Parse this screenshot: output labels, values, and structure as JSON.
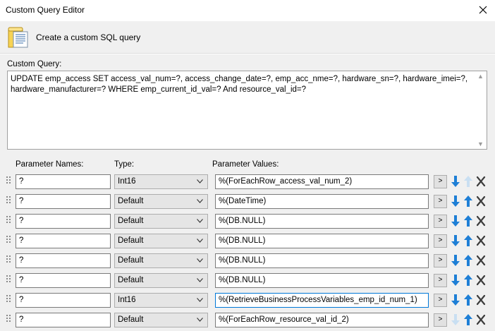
{
  "window": {
    "title": "Custom Query Editor"
  },
  "banner": {
    "text": "Create a custom SQL query"
  },
  "query": {
    "label": "Custom Query:",
    "text": "UPDATE emp_access SET access_val_num=?, access_change_date=?, emp_acc_nme=?, hardware_sn=?, hardware_imei=?, hardware_manufacturer=? WHERE emp_current_id_val=? And resource_val_id=?"
  },
  "columns": {
    "names": "Parameter Names:",
    "type": "Type:",
    "values": "Parameter Values:"
  },
  "more_label": ">",
  "params": [
    {
      "name": "?",
      "type": "Int16",
      "value": "%(ForEachRow_access_val_num_2)",
      "up_enabled": false,
      "down_enabled": true
    },
    {
      "name": "?",
      "type": "Default",
      "value": "%(DateTime)",
      "up_enabled": true,
      "down_enabled": true
    },
    {
      "name": "?",
      "type": "Default",
      "value": "%(DB.NULL)",
      "up_enabled": true,
      "down_enabled": true
    },
    {
      "name": "?",
      "type": "Default",
      "value": "%(DB.NULL)",
      "up_enabled": true,
      "down_enabled": true
    },
    {
      "name": "?",
      "type": "Default",
      "value": "%(DB.NULL)",
      "up_enabled": true,
      "down_enabled": true
    },
    {
      "name": "?",
      "type": "Default",
      "value": "%(DB.NULL)",
      "up_enabled": true,
      "down_enabled": true
    },
    {
      "name": "?",
      "type": "Int16",
      "value": "%(RetrieveBusinessProcessVariables_emp_id_num_1)",
      "up_enabled": true,
      "down_enabled": true
    },
    {
      "name": "?",
      "type": "Default",
      "value": "%(ForEachRow_resource_val_id_2)",
      "up_enabled": true,
      "down_enabled": false
    }
  ],
  "icons": {
    "banner": "database-script-icon",
    "close": "close-icon",
    "move_down": "arrow-down-icon",
    "move_up": "arrow-up-icon",
    "delete": "delete-x-icon",
    "dropdown": "chevron-down-icon",
    "drag": "drag-handle-icon"
  },
  "colors": {
    "arrow_active": "#1e7fd6",
    "arrow_disabled": "#c9dff2",
    "focus_border": "#0078d7",
    "panel_bg": "#f0f0f0"
  }
}
